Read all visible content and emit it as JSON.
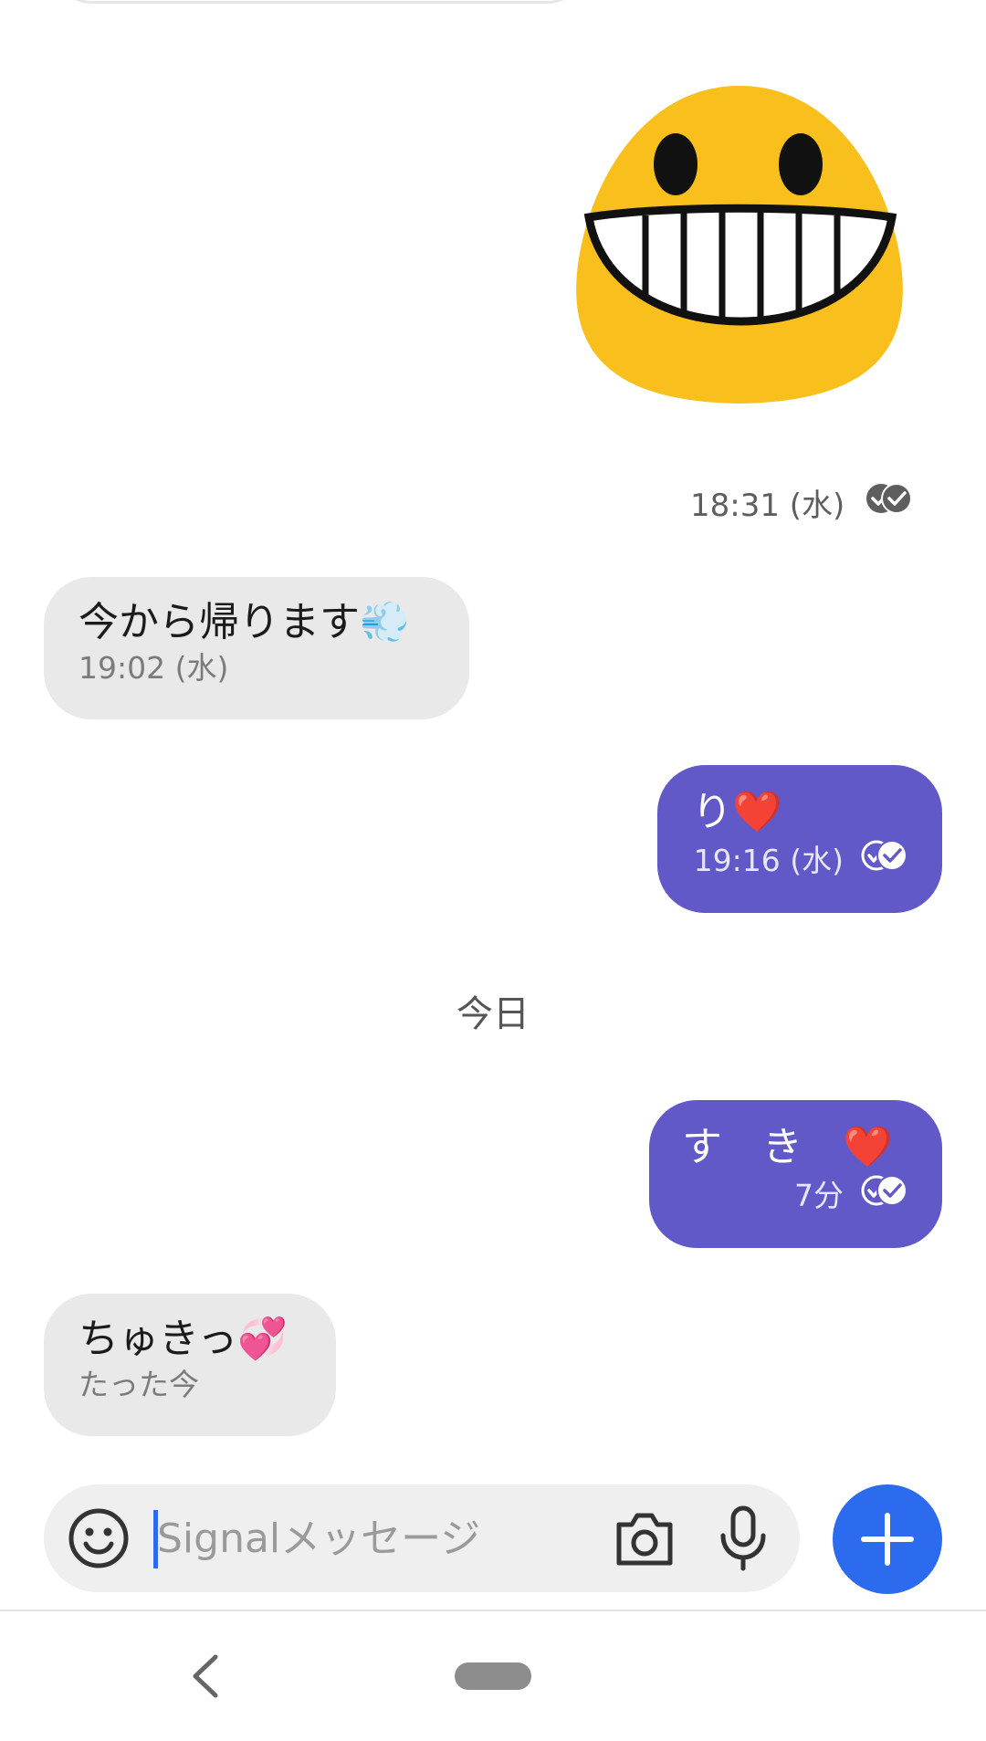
{
  "messages": [
    {
      "direction": "out",
      "type": "sticker",
      "sticker": "grinning-face-sticker",
      "time": "18:31 (水)",
      "status": "delivered"
    },
    {
      "direction": "in",
      "text": "今から帰ります💨",
      "time": "19:02 (水)"
    },
    {
      "direction": "out",
      "text": "り❤️",
      "time": "19:16 (水)",
      "status": "delivered"
    },
    {
      "direction": "out",
      "text": "す　き　❤️",
      "time": "7分",
      "status": "delivered"
    },
    {
      "direction": "in",
      "text": "ちゅきっ💞",
      "time": "たった今"
    }
  ],
  "date_separator": "今日",
  "composer": {
    "placeholder": "Signalメッセージ",
    "value": ""
  },
  "icons": {
    "emoji": "emoji-icon",
    "camera": "camera-icon",
    "mic": "microphone-icon",
    "send": "plus-icon",
    "ticks": "double-check-icon",
    "back": "back-icon",
    "home": "home-pill-icon"
  },
  "colors": {
    "outgoing_bubble": "#6259c9",
    "incoming_bubble": "#e9e9e9",
    "send_button": "#2c6bed",
    "sticker_face": "#f9bf1c"
  }
}
